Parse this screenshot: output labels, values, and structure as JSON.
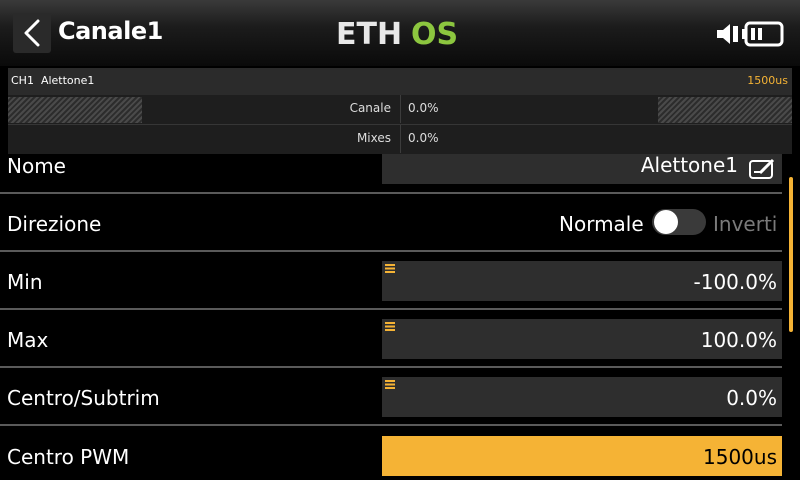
{
  "header": {
    "title": "Canale1",
    "logo_text": "ETHOS",
    "logo_colors": {
      "eth": "#e8e8e8",
      "os": "#8cc63f"
    },
    "back_icon": "chevron-left-icon",
    "status_icons": [
      "speaker-icon",
      "battery-icon"
    ]
  },
  "info": {
    "channel": "CH1",
    "channel_name": "Alettone1",
    "pulse": "1500us",
    "rows": [
      {
        "label": "Canale",
        "value": "0.0%"
      },
      {
        "label": "Mixes",
        "value": "0.0%"
      }
    ]
  },
  "settings": {
    "nome": {
      "label": "Nome",
      "value": "Alettone1"
    },
    "direzione": {
      "label": "Direzione",
      "option_left": "Normale",
      "option_right": "Inverti",
      "inverted": false
    },
    "min": {
      "label": "Min",
      "value": "-100.0%"
    },
    "max": {
      "label": "Max",
      "value": "100.0%"
    },
    "centro": {
      "label": "Centro/Subtrim",
      "value": "0.0%"
    },
    "pwm": {
      "label": "Centro PWM",
      "value": "1500us"
    }
  },
  "colors": {
    "accent": "#f5b335",
    "background": "#000000",
    "field": "#2e2e2e"
  }
}
